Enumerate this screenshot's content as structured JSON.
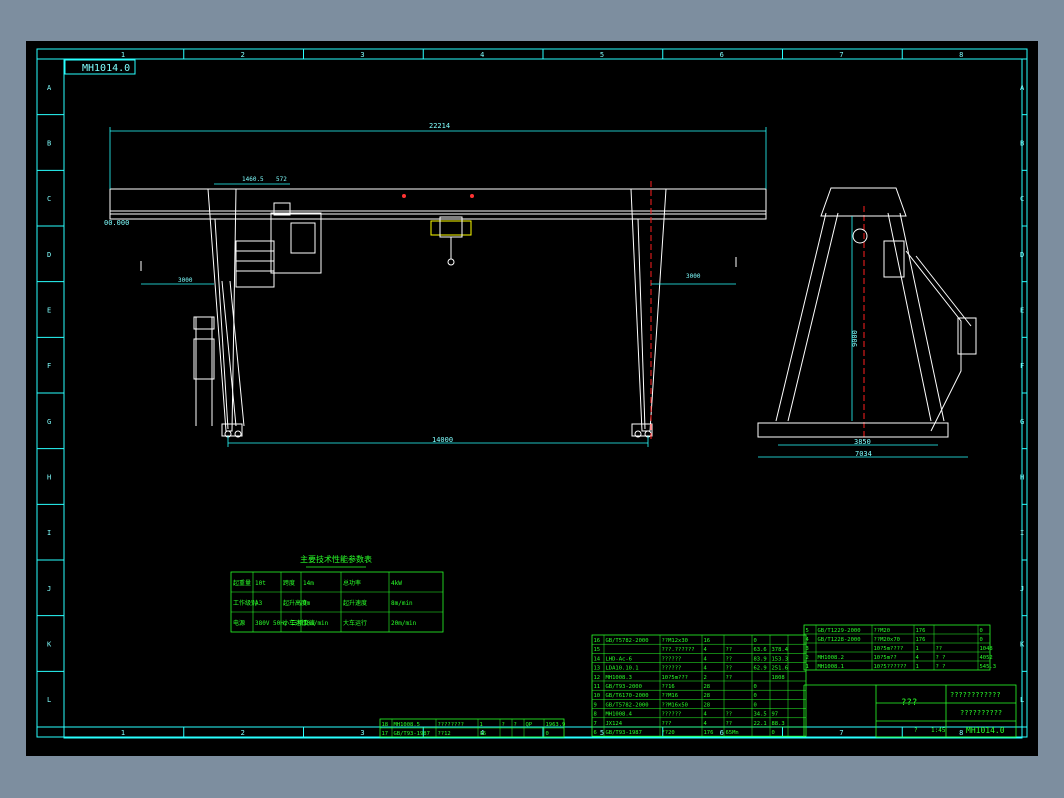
{
  "drawing": {
    "code_stamp": "MH1014.0",
    "column_labels": [
      "1",
      "2",
      "3",
      "4",
      "5",
      "6",
      "7",
      "8"
    ],
    "row_labels": [
      "A",
      "B",
      "C",
      "D",
      "E",
      "F",
      "G",
      "H",
      "I",
      "J",
      "K",
      "L"
    ],
    "colors": {
      "background": "#000000",
      "frame": "#29ffff",
      "structure": "#ffffff",
      "text": "#29ff29",
      "centerline": "#ff2020",
      "hook": "#ffff00"
    }
  },
  "front_view": {
    "overall_span": "22214",
    "rail_gauge": "14000",
    "dim_left_1": "1460.5",
    "dim_left_2": "572",
    "left_cantilever": "3000",
    "right_cantilever": "3000",
    "elevation": "00.000"
  },
  "side_view": {
    "lift_height": "9000",
    "wheel_base": "3850",
    "base_width": "7034"
  },
  "spec_table": {
    "title": "主要技术性能参数表",
    "rows": [
      [
        "起重量",
        "10t",
        "跨度",
        "14m",
        "总功率",
        "4kW"
      ],
      [
        "工作级别",
        "A3",
        "起升高度",
        "9m",
        "起升速度",
        "8m/min"
      ],
      [
        "电源",
        "380V 50Hz 三相交流",
        "小车运行",
        "20m/min",
        "大车运行",
        "20m/min"
      ]
    ]
  },
  "parts_list_left": [
    [
      "16",
      "GB/T5782-2000",
      "??M12x30",
      "16",
      "",
      "0",
      ""
    ],
    [
      "15",
      "",
      "???.??????",
      "4",
      "??",
      "63.6",
      "378.4",
      ""
    ],
    [
      "14",
      "LHD-Ac-6",
      "??????",
      "4",
      "??",
      "83.9",
      "153.3",
      ""
    ],
    [
      "13",
      "LDA10.10.1",
      "??????",
      "4",
      "??",
      "62.9",
      "251.6",
      ""
    ],
    [
      "12",
      "MH1008.3",
      "10?5m???",
      "2",
      "??",
      "",
      "1808",
      ""
    ],
    [
      "11",
      "GB/T93-2000",
      "??16",
      "28",
      "",
      "0",
      ""
    ],
    [
      "10",
      "GB/T6170-2000",
      "??M16",
      "28",
      "",
      "0",
      ""
    ],
    [
      "9",
      "GB/T5782-2000",
      "??M16x50",
      "28",
      "",
      "0",
      ""
    ],
    [
      "8",
      "MH1008.4",
      "??????",
      "4",
      "??",
      "34.5",
      "97",
      ""
    ],
    [
      "7",
      "JX124",
      "???",
      "4",
      "??",
      "22.1",
      "88.3",
      ""
    ],
    [
      "6",
      "GB/T93-1987",
      "??20",
      "176",
      "65Mn",
      "",
      "0",
      ""
    ]
  ],
  "parts_list_bottom": [
    [
      "18",
      "MH1008.5",
      "????????",
      "1",
      "?",
      "?",
      "QP",
      "1963.9"
    ],
    [
      "17",
      "GB/T93-1987",
      "??12",
      "16",
      "",
      "",
      "",
      "0"
    ]
  ],
  "parts_list_right": [
    [
      "5",
      "GB/T1229-2000",
      "??M20",
      "176",
      "",
      "0"
    ],
    [
      "4",
      "GB/T1228-2000",
      "??M20x70",
      "176",
      "",
      "0"
    ],
    [
      "3",
      "",
      "10?5m????",
      "1",
      "??",
      "1048"
    ],
    [
      "2",
      "MH1008.2",
      "10?5m??",
      "4",
      "? ?",
      "4052"
    ],
    [
      "1",
      "MH1008.1",
      "10?5??????",
      "1",
      "? ?",
      "545.3"
    ]
  ],
  "title_block": {
    "company": "????????????",
    "drawing_name": "???",
    "drawing_title": "??????????",
    "drawing_number": "MH1014.0",
    "qty": "?",
    "scale": "1:45"
  }
}
